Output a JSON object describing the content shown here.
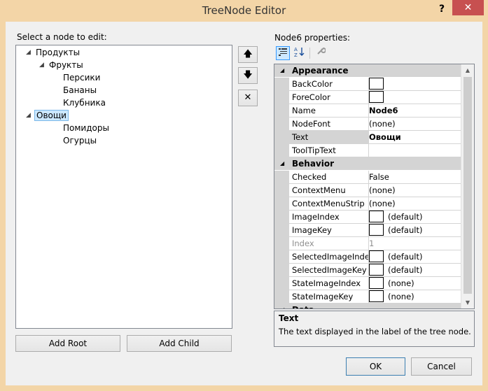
{
  "window": {
    "title": "TreeNode Editor",
    "help_glyph": "?",
    "close_glyph": "✕"
  },
  "left": {
    "label": "Select a node to edit:",
    "tree": [
      {
        "text": "Продукты",
        "expanded": true
      },
      {
        "text": "Фрукты",
        "expanded": true
      },
      {
        "text": "Персики"
      },
      {
        "text": "Бананы"
      },
      {
        "text": "Клубника"
      },
      {
        "text": "Овощи",
        "expanded": true,
        "selected": true
      },
      {
        "text": "Помидоры"
      },
      {
        "text": "Огурцы"
      }
    ],
    "add_root_label": "Add Root",
    "add_child_label": "Add Child"
  },
  "move_buttons": {
    "up_glyph": "🡅",
    "down_glyph": "🡇",
    "delete_glyph": "✕"
  },
  "properties": {
    "label": "Node6 properties:",
    "categories": [
      {
        "name": "Appearance",
        "rows": [
          {
            "name": "BackColor",
            "value": "",
            "swatch": true
          },
          {
            "name": "ForeColor",
            "value": "",
            "swatch": true
          },
          {
            "name": "Name",
            "value": "Node6",
            "bold": true
          },
          {
            "name": "NodeFont",
            "value": "(none)"
          },
          {
            "name": "Text",
            "value": "Овощи",
            "bold": true,
            "selected": true
          },
          {
            "name": "ToolTipText",
            "value": ""
          }
        ]
      },
      {
        "name": "Behavior",
        "rows": [
          {
            "name": "Checked",
            "value": "False"
          },
          {
            "name": "ContextMenu",
            "value": "(none)"
          },
          {
            "name": "ContextMenuStrip",
            "value": "(none)"
          },
          {
            "name": "ImageIndex",
            "value": "(default)",
            "swatch": true
          },
          {
            "name": "ImageKey",
            "value": "(default)",
            "swatch": true
          },
          {
            "name": "Index",
            "value": "1",
            "disabled": true
          },
          {
            "name": "SelectedImageIndex",
            "value": "(default)",
            "swatch": true
          },
          {
            "name": "SelectedImageKey",
            "value": "(default)",
            "swatch": true
          },
          {
            "name": "StateImageIndex",
            "value": "(none)",
            "swatch": true
          },
          {
            "name": "StateImageKey",
            "value": "(none)",
            "swatch": true
          }
        ]
      },
      {
        "name": "Data",
        "rows": []
      }
    ],
    "description_title": "Text",
    "description_text": "The text displayed in the label of the tree node."
  },
  "footer": {
    "ok_label": "OK",
    "cancel_label": "Cancel"
  },
  "colors": {
    "title_bar": "#f3d5a7",
    "close": "#c75050",
    "selection": "#cce8ff"
  }
}
